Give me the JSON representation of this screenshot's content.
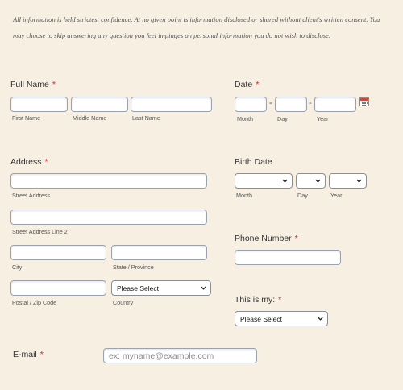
{
  "notice": "All information is held strictest confidence. At no given point is information disclosed or shared without client's written consent. You may choose to skip answering any question you feel impinges on personal information you do not wish to disclose.",
  "required_mark": "*",
  "full_name": {
    "label": "Full Name",
    "first": "First Name",
    "middle": "Middle Name",
    "last": "Last Name"
  },
  "date": {
    "label": "Date",
    "separator": "-",
    "month": "Month",
    "day": "Day",
    "year": "Year"
  },
  "address": {
    "label": "Address",
    "street": "Street Address",
    "street2": "Street Address Line 2",
    "city": "City",
    "state": "State / Province",
    "postal": "Postal / Zip Code",
    "country": "Country",
    "country_value": "Please Select"
  },
  "birth_date": {
    "label": "Birth Date",
    "month": "Month",
    "day": "Day",
    "year": "Year"
  },
  "phone": {
    "label": "Phone Number"
  },
  "this_is_my": {
    "label": "This is my:",
    "value": "Please Select"
  },
  "email": {
    "label": "E-mail",
    "placeholder": "ex: myname@example.com"
  },
  "colors": {
    "background": "#f6efe2",
    "required": "#d0262b"
  }
}
